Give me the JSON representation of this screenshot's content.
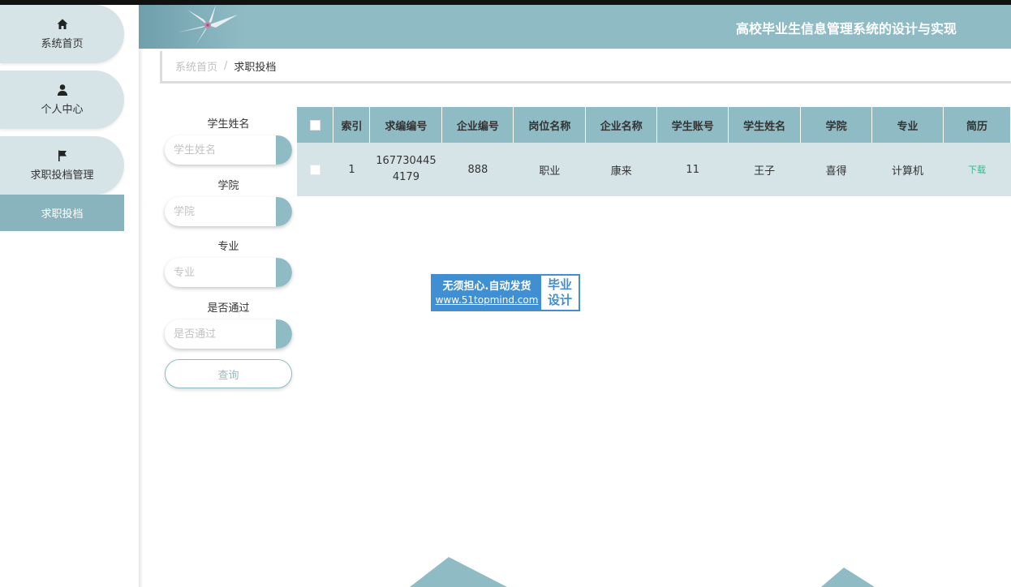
{
  "header": {
    "title": "高校毕业生信息管理系统的设计与实现"
  },
  "sidebar": {
    "items": [
      {
        "label": "系统首页",
        "icon": "home-icon"
      },
      {
        "label": "个人中心",
        "icon": "user-icon"
      },
      {
        "label": "求职投档管理",
        "icon": "flag-icon"
      }
    ],
    "sub_item": "求职投档"
  },
  "breadcrumb": {
    "home": "系统首页",
    "separator": "/",
    "current": "求职投档"
  },
  "search": {
    "fields": [
      {
        "label": "学生姓名",
        "placeholder": "学生姓名"
      },
      {
        "label": "学院",
        "placeholder": "学院"
      },
      {
        "label": "专业",
        "placeholder": "专业"
      },
      {
        "label": "是否通过",
        "placeholder": "是否通过"
      }
    ],
    "query_label": "查询"
  },
  "table": {
    "headers": [
      "索引",
      "求编编号",
      "企业编号",
      "岗位名称",
      "企业名称",
      "学生账号",
      "学生姓名",
      "学院",
      "专业",
      "简历"
    ],
    "rows": [
      {
        "index": "1",
        "apply_no_line1": "167730445",
        "apply_no_line2": "4179",
        "company_no": "888",
        "position": "职业",
        "company": "康来",
        "account": "11",
        "student": "王子",
        "college": "喜得",
        "major": "计算机",
        "resume_link": "下载"
      }
    ]
  },
  "watermark": {
    "line1": "无须担心.自动发货",
    "line2": "www.51topmind.com",
    "right1": "毕业",
    "right2": "设计"
  },
  "colors": {
    "accent": "#8fbbc4",
    "pill": "#d6e4e8",
    "sub_item": "#8ab4bd",
    "download_link": "#3ab68a"
  }
}
